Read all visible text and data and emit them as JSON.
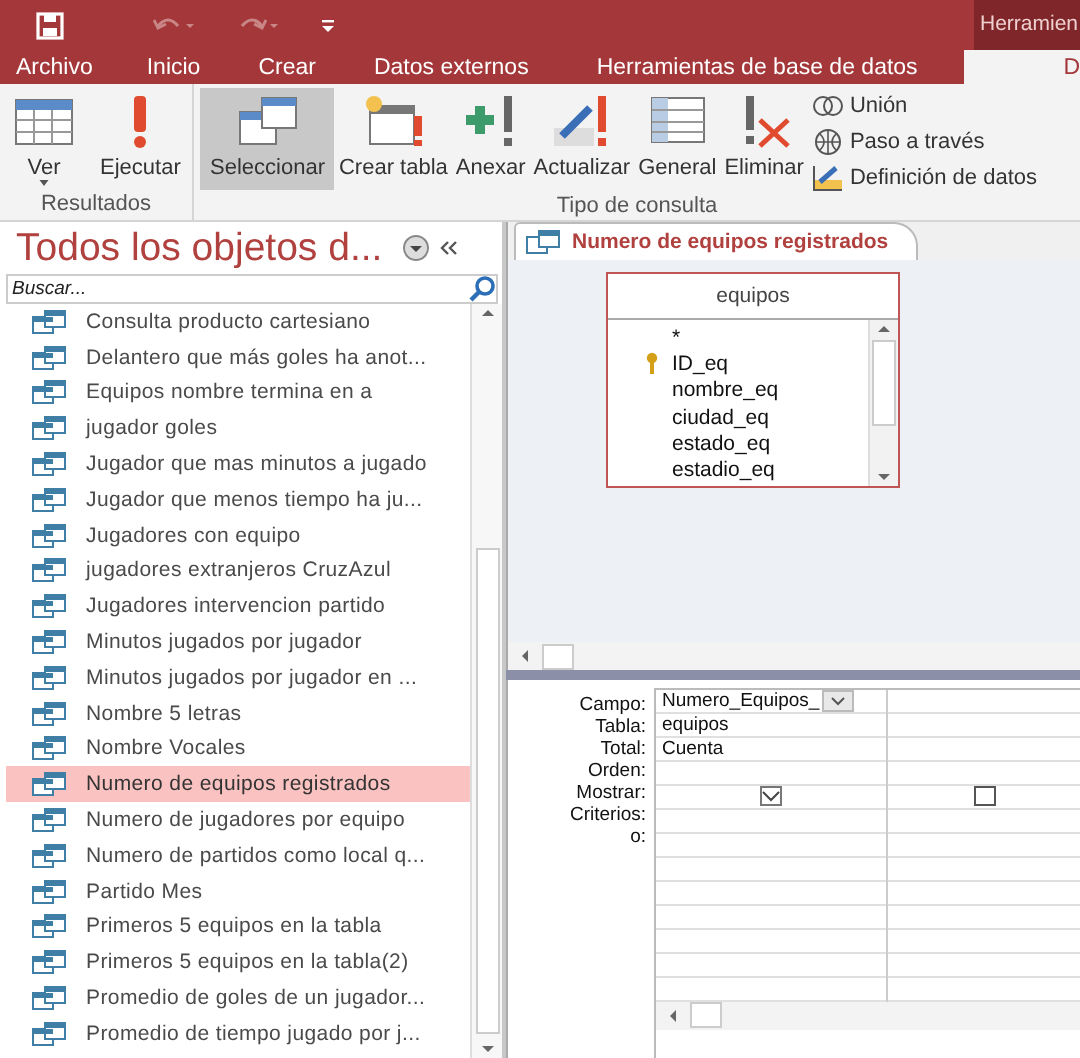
{
  "title_bar": {
    "contextual_tab": "Herramien"
  },
  "tabs": [
    {
      "label": "Archivo",
      "selected": false
    },
    {
      "label": "Inicio",
      "selected": false
    },
    {
      "label": "Crear",
      "selected": false
    },
    {
      "label": "Datos externos",
      "selected": false
    },
    {
      "label": "Herramientas de base de datos",
      "selected": false
    },
    {
      "label": "D",
      "selected": true
    }
  ],
  "ribbon": {
    "groups": [
      {
        "label": "Resultados",
        "buttons": [
          {
            "kind": "ver",
            "label": "Ver",
            "selected": false
          },
          {
            "kind": "ejecutar",
            "label": "Ejecutar",
            "selected": false
          }
        ]
      },
      {
        "label": "Tipo de consulta",
        "buttons": [
          {
            "kind": "seleccionar",
            "label": "Seleccionar",
            "selected": true
          },
          {
            "kind": "crear",
            "label": "Crear tabla",
            "selected": false
          },
          {
            "kind": "anexar",
            "label": "Anexar",
            "selected": false
          },
          {
            "kind": "actualizar",
            "label": "Actualizar",
            "selected": false
          },
          {
            "kind": "general",
            "label": "General",
            "selected": false
          },
          {
            "kind": "eliminar",
            "label": "Eliminar",
            "selected": false
          }
        ],
        "small_buttons": [
          {
            "kind": "union",
            "label": "Unión"
          },
          {
            "kind": "paso",
            "label": "Paso a través"
          },
          {
            "kind": "definicion",
            "label": "Definición de datos"
          }
        ]
      }
    ]
  },
  "nav_pane": {
    "title": "Todos los objetos d...",
    "search": {
      "placeholder": "Buscar..."
    },
    "items": [
      {
        "label": "Consulta producto cartesiano",
        "selected": false
      },
      {
        "label": "Delantero que más goles ha anot...",
        "selected": false
      },
      {
        "label": "Equipos nombre termina en a",
        "selected": false
      },
      {
        "label": "jugador goles",
        "selected": false
      },
      {
        "label": "Jugador que mas minutos a jugado",
        "selected": false
      },
      {
        "label": "Jugador que menos tiempo ha ju...",
        "selected": false
      },
      {
        "label": "Jugadores con equipo",
        "selected": false
      },
      {
        "label": "jugadores extranjeros CruzAzul",
        "selected": false
      },
      {
        "label": "Jugadores intervencion partido",
        "selected": false
      },
      {
        "label": "Minutos jugados por jugador",
        "selected": false
      },
      {
        "label": "Minutos jugados por jugador en ...",
        "selected": false
      },
      {
        "label": "Nombre 5 letras",
        "selected": false
      },
      {
        "label": "Nombre Vocales",
        "selected": false
      },
      {
        "label": "Numero de equipos registrados",
        "selected": true
      },
      {
        "label": "Numero de jugadores por equipo",
        "selected": false
      },
      {
        "label": "Numero de partidos como local q...",
        "selected": false
      },
      {
        "label": "Partido Mes",
        "selected": false
      },
      {
        "label": "Primeros 5 equipos en la tabla",
        "selected": false
      },
      {
        "label": "Primeros 5 equipos en la tabla(2)",
        "selected": false
      },
      {
        "label": "Promedio de goles de un jugador...",
        "selected": false
      },
      {
        "label": "Promedio de tiempo jugado por j...",
        "selected": false
      }
    ]
  },
  "document_tab": {
    "label": "Numero de equipos registrados"
  },
  "table_box": {
    "title": "equipos",
    "fields": [
      {
        "name": "*",
        "key": false
      },
      {
        "name": "ID_eq",
        "key": true
      },
      {
        "name": "nombre_eq",
        "key": false
      },
      {
        "name": "ciudad_eq",
        "key": false
      },
      {
        "name": "estado_eq",
        "key": false
      },
      {
        "name": "estadio_eq",
        "key": false
      }
    ]
  },
  "query_grid": {
    "row_labels": [
      "Campo:",
      "Tabla:",
      "Total:",
      "Orden:",
      "Mostrar:",
      "Criterios:",
      "o:"
    ],
    "columns": [
      {
        "field": "Numero_Equipos_",
        "table": "equipos",
        "total": "Cuenta",
        "show": true
      },
      {
        "show": false
      }
    ]
  }
}
